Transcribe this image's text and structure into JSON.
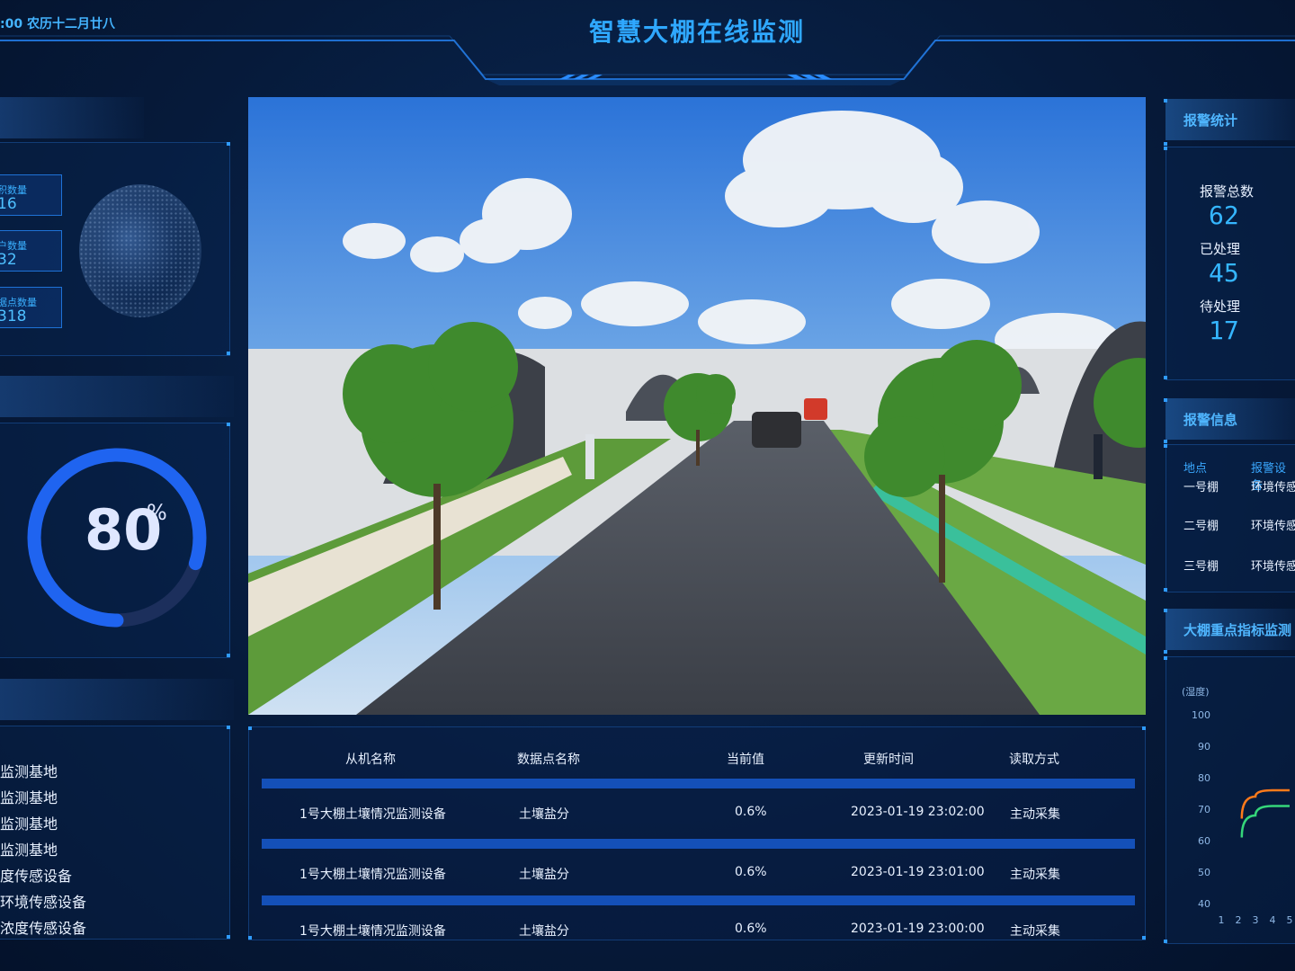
{
  "header": {
    "title": "智慧大棚在线监测",
    "datetime": ":00  农历十二月廿八"
  },
  "left": {
    "stats": [
      {
        "label": "积数量",
        "value": "16"
      },
      {
        "label": "户数量",
        "value": "32"
      },
      {
        "label": "据点数量",
        "value": "318"
      }
    ],
    "gauge": {
      "value": "80",
      "unit": "%",
      "fraction": 0.8
    },
    "base_list": [
      "监测基地",
      "监测基地",
      "监测基地",
      "监测基地",
      "度传感设备",
      "环境传感设备",
      "浓度传感设备"
    ]
  },
  "table": {
    "headers": [
      "从机名称",
      "数据点名称",
      "当前值",
      "更新时间",
      "读取方式"
    ],
    "rows": [
      [
        "1号大棚土壤情况监测设备",
        "土壤盐分",
        "0.6%",
        "2023-01-19  23:02:00",
        "主动采集"
      ],
      [
        "1号大棚土壤情况监测设备",
        "土壤盐分",
        "0.6%",
        "2023-01-19  23:01:00",
        "主动采集"
      ],
      [
        "1号大棚土壤情况监测设备",
        "土壤盐分",
        "0.6%",
        "2023-01-19  23:00:00",
        "主动采集"
      ]
    ]
  },
  "right": {
    "alarm_stats_title": "报警统计",
    "total_label": "报警总数",
    "total_value": "62",
    "handled_label": "已处理",
    "handled_value": "45",
    "pending_label": "待处理",
    "pending_value": "17",
    "alarm_info_title": "报警信息",
    "alarm_info_headers": [
      "地点",
      "报警设备"
    ],
    "alarm_info_rows": [
      [
        "一号棚",
        "环境传感"
      ],
      [
        "二号棚",
        "环境传感"
      ],
      [
        "三号棚",
        "环境传感"
      ]
    ],
    "indicator_title": "大棚重点指标监测"
  },
  "chart_data": {
    "type": "line",
    "ylabel": "(湿度)",
    "ylim": [
      40,
      100
    ],
    "y_ticks": [
      "100",
      "90",
      "80",
      "70",
      "60",
      "50",
      "40"
    ],
    "x_ticks": [
      "1",
      "2",
      "3",
      "4",
      "5"
    ],
    "series": [
      {
        "color": "#ff7a1a",
        "x": [
          2.2,
          3,
          4,
          5
        ],
        "values": [
          67,
          74,
          76,
          76
        ]
      },
      {
        "color": "#35d67a",
        "x": [
          2.2,
          3,
          4,
          5
        ],
        "values": [
          61,
          68,
          71,
          71
        ]
      }
    ]
  },
  "colors": {
    "accent": "#2fa8ff",
    "panel_border": "#1e72d6",
    "table_bar": "#1450b8",
    "gauge": "#1f64f0"
  }
}
